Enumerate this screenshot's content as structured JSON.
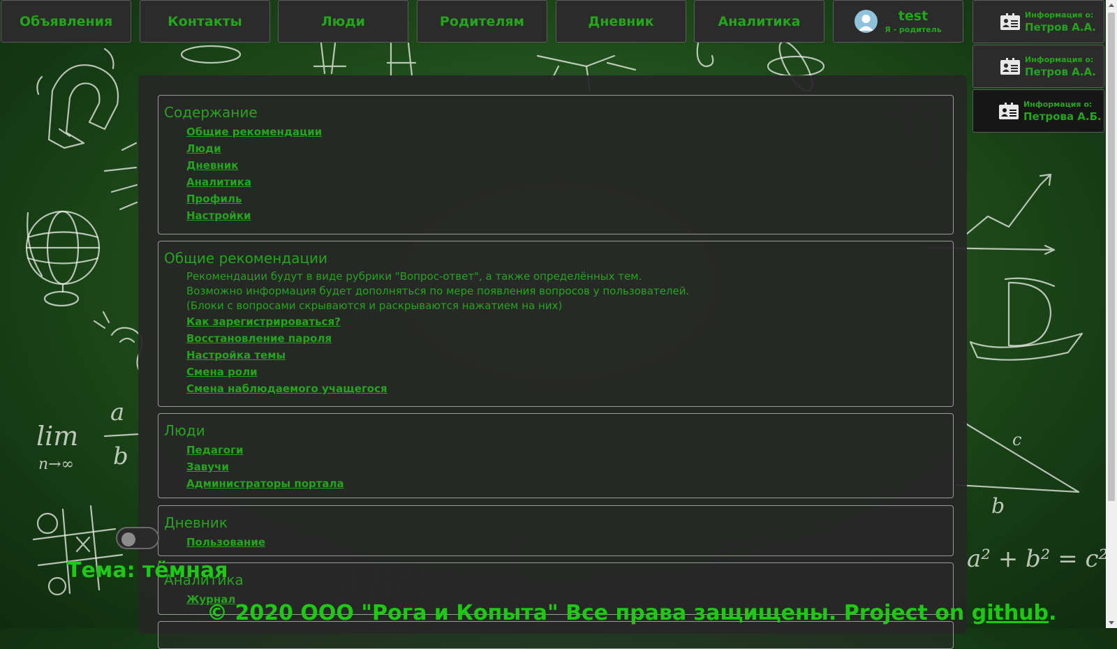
{
  "nav": {
    "items": [
      "Объявления",
      "Контакты",
      "Люди",
      "Родителям",
      "Дневник",
      "Аналитика"
    ],
    "profile": {
      "name": "test",
      "role": "Я - родитель"
    }
  },
  "info_cards": [
    {
      "label": "Информация о:",
      "name": "Петров А.А."
    },
    {
      "label": "Информация о:",
      "name": "Петров А.А."
    },
    {
      "label": "Информация о:",
      "name": "Петрова А.Б."
    }
  ],
  "sections": {
    "contents": {
      "title": "Содержание",
      "links": [
        "Общие рекомендации",
        "Люди",
        "Дневник",
        "Аналитика",
        "Профиль",
        "Настройки"
      ]
    },
    "general": {
      "title": "Общие рекомендации",
      "paragraphs": [
        "Рекомендации будут в виде рубрики \"Вопрос-ответ\", а также определённых тем.",
        "Возможно информация будет дополняться по мере появления вопросов у пользователей.",
        "(Блоки с вопросами скрываются и раскрываются нажатием на них)"
      ],
      "links": [
        "Как зарегистрироваться?",
        "Восстановление пароля",
        "Настройка темы",
        "Смена роли",
        "Смена наблюдаемого учащегося"
      ]
    },
    "people": {
      "title": "Люди",
      "links": [
        "Педагоги",
        "Завучи",
        "Администраторы портала"
      ]
    },
    "diary": {
      "title": "Дневник",
      "links": [
        "Пользование"
      ]
    },
    "analytics": {
      "title": "Аналитика",
      "links": [
        "Журнал"
      ]
    }
  },
  "theme": {
    "label": "Тема: тёмная"
  },
  "footer": {
    "text": "© 2020 ООО \"Рога и Копыта\" Все права защищены. Project on ",
    "link": "github",
    "tail": "."
  },
  "colors": {
    "accent": "#25a51e",
    "panel": "#2b2b2b",
    "board": "#24561f"
  },
  "icons": [
    "user-avatar-icon",
    "id-card-icon"
  ]
}
